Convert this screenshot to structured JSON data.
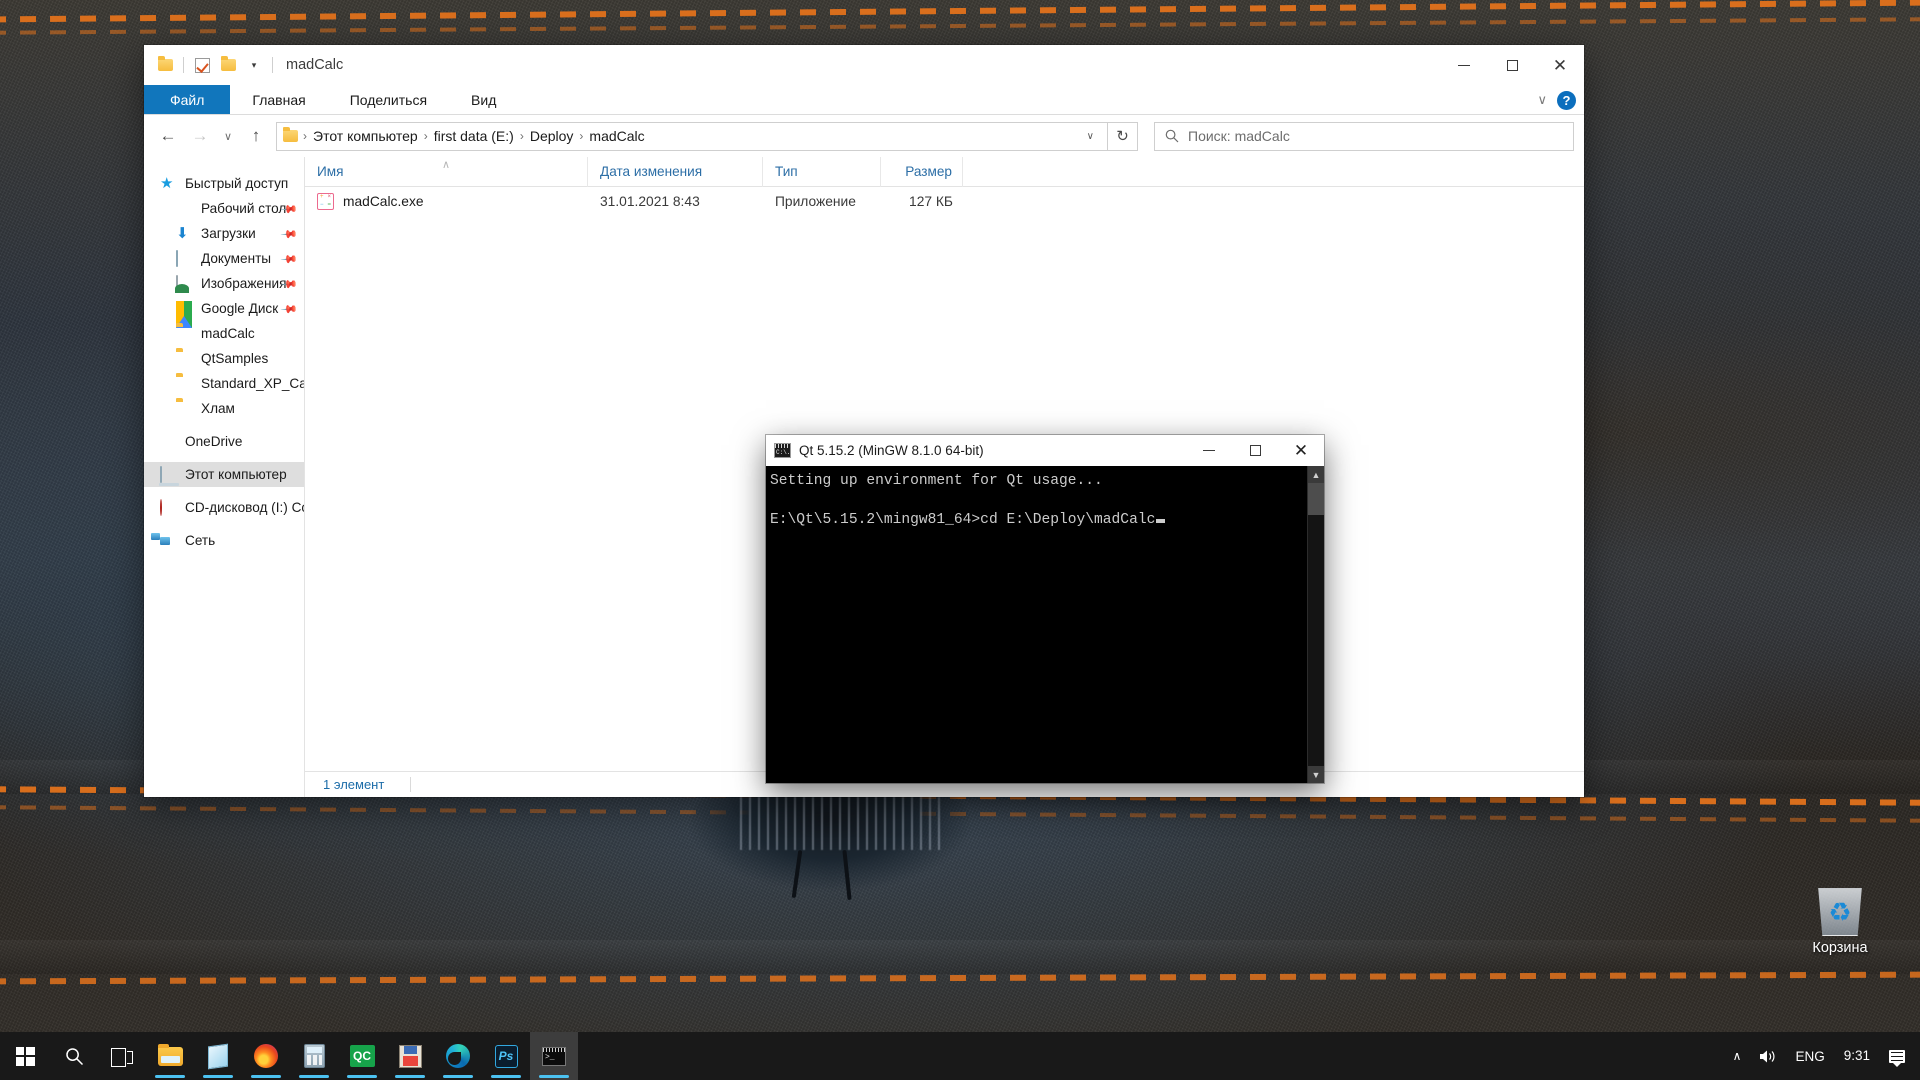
{
  "explorer": {
    "window_title": "madCalc",
    "quick_access_toolbar": [
      {
        "name": "properties-folder-icon",
        "label": ""
      },
      {
        "name": "new-folder-check-icon",
        "label": ""
      },
      {
        "name": "folder-icon",
        "label": ""
      },
      {
        "name": "customize-qat-caret",
        "label": "▾"
      }
    ],
    "window_controls": {
      "minimize": "—",
      "maximize": "□",
      "close": "✕"
    },
    "ribbon": {
      "tabs": [
        {
          "label": "Файл",
          "active": true
        },
        {
          "label": "Главная",
          "active": false
        },
        {
          "label": "Поделиться",
          "active": false
        },
        {
          "label": "Вид",
          "active": false
        }
      ],
      "collapse_caret": "∨",
      "help_label": "?"
    },
    "navigation": {
      "back": "←",
      "forward": "→",
      "recent_caret": "∨",
      "up": "↑",
      "refresh": "↻",
      "address_caret": "∨",
      "breadcrumbs": [
        "Этот компьютер",
        "first data (E:)",
        "Deploy",
        "madCalc"
      ],
      "separator": "›"
    },
    "search": {
      "placeholder": "Поиск: madCalc",
      "value": ""
    },
    "nav_pane": [
      {
        "label": "Быстрый доступ",
        "icon": "star-icon",
        "indent": false,
        "pinned": false,
        "selected": false
      },
      {
        "label": "Рабочий стол",
        "icon": "desktop-icon",
        "indent": true,
        "pinned": true,
        "selected": false
      },
      {
        "label": "Загрузки",
        "icon": "downloads-icon",
        "indent": true,
        "pinned": true,
        "selected": false
      },
      {
        "label": "Документы",
        "icon": "documents-icon",
        "indent": true,
        "pinned": true,
        "selected": false
      },
      {
        "label": "Изображения",
        "icon": "pictures-icon",
        "indent": true,
        "pinned": true,
        "selected": false
      },
      {
        "label": "Google Диск",
        "icon": "google-drive-icon",
        "indent": true,
        "pinned": true,
        "selected": false
      },
      {
        "label": "madCalc",
        "icon": "folder-icon",
        "indent": true,
        "pinned": false,
        "selected": false
      },
      {
        "label": "QtSamples",
        "icon": "folder-icon",
        "indent": true,
        "pinned": false,
        "selected": false
      },
      {
        "label": "Standard_XP_Calcul",
        "icon": "folder-icon",
        "indent": true,
        "pinned": false,
        "selected": false
      },
      {
        "label": "Хлам",
        "icon": "folder-icon",
        "indent": true,
        "pinned": false,
        "selected": false
      },
      {
        "label": "OneDrive",
        "icon": "onedrive-icon",
        "indent": false,
        "pinned": false,
        "selected": false,
        "gap_before": true
      },
      {
        "label": "Этот компьютер",
        "icon": "this-pc-icon",
        "indent": false,
        "pinned": false,
        "selected": true,
        "gap_before": true
      },
      {
        "label": "CD-дисковод (I:) Con",
        "icon": "cd-drive-icon",
        "indent": false,
        "pinned": false,
        "selected": false,
        "gap_before": true
      },
      {
        "label": "Сеть",
        "icon": "network-icon",
        "indent": false,
        "pinned": false,
        "selected": false,
        "gap_before": true
      }
    ],
    "columns": [
      {
        "label": "Имя",
        "sorted": true,
        "sort_caret": "∧"
      },
      {
        "label": "Дата изменения",
        "sorted": false
      },
      {
        "label": "Тип",
        "sorted": false
      },
      {
        "label": "Размер",
        "sorted": false
      }
    ],
    "files": [
      {
        "name": "madCalc.exe",
        "date": "31.01.2021 8:43",
        "type": "Приложение",
        "size": "127 КБ",
        "icon": "exe-calculator-icon"
      }
    ],
    "status": "1 элемент"
  },
  "console": {
    "title": "Qt 5.15.2 (MinGW 8.1.0 64-bit)",
    "icon": "cmd-icon",
    "window_controls": {
      "minimize": "—",
      "maximize": "□",
      "close": "✕"
    },
    "lines": [
      "Setting up environment for Qt usage...",
      "",
      "E:\\Qt\\5.15.2\\mingw81_64>cd E:\\Deploy\\madCalc"
    ],
    "scrollbar": {
      "up_arrow": "▲",
      "down_arrow": "▼"
    }
  },
  "desktop": {
    "icons": [
      {
        "label": "Корзина",
        "icon": "recycle-bin-icon"
      }
    ]
  },
  "taskbar": {
    "start": {
      "name": "start-button",
      "label": ""
    },
    "search": {
      "name": "search-icon",
      "label": ""
    },
    "task_view": {
      "name": "task-view-icon",
      "label": ""
    },
    "apps": [
      {
        "name": "file-explorer-icon",
        "label": "",
        "running": true,
        "active": false
      },
      {
        "name": "sticky-notes-icon",
        "label": "",
        "running": true,
        "active": false
      },
      {
        "name": "firefox-icon",
        "label": "",
        "running": true,
        "active": false
      },
      {
        "name": "calculator-icon",
        "label": "",
        "running": true,
        "active": false
      },
      {
        "name": "qc-icon",
        "label": "QC",
        "running": true,
        "active": false
      },
      {
        "name": "save-app-icon",
        "label": "",
        "running": true,
        "active": false
      },
      {
        "name": "microsoft-edge-icon",
        "label": "",
        "running": true,
        "active": false
      },
      {
        "name": "photoshop-icon",
        "label": "Ps",
        "running": true,
        "active": false
      },
      {
        "name": "command-prompt-icon",
        "label": "",
        "running": true,
        "active": true
      }
    ],
    "tray": {
      "show_hidden": "∧",
      "volume": "🔊",
      "language": "ENG",
      "clock": "9:31",
      "notifications": ""
    }
  },
  "colors": {
    "accent_blue": "#1176bc",
    "link_blue": "#2c6ea6",
    "taskbar": "#191919",
    "console_bg": "#000000",
    "console_text": "#cccccc",
    "selection_gray": "#dedede"
  }
}
